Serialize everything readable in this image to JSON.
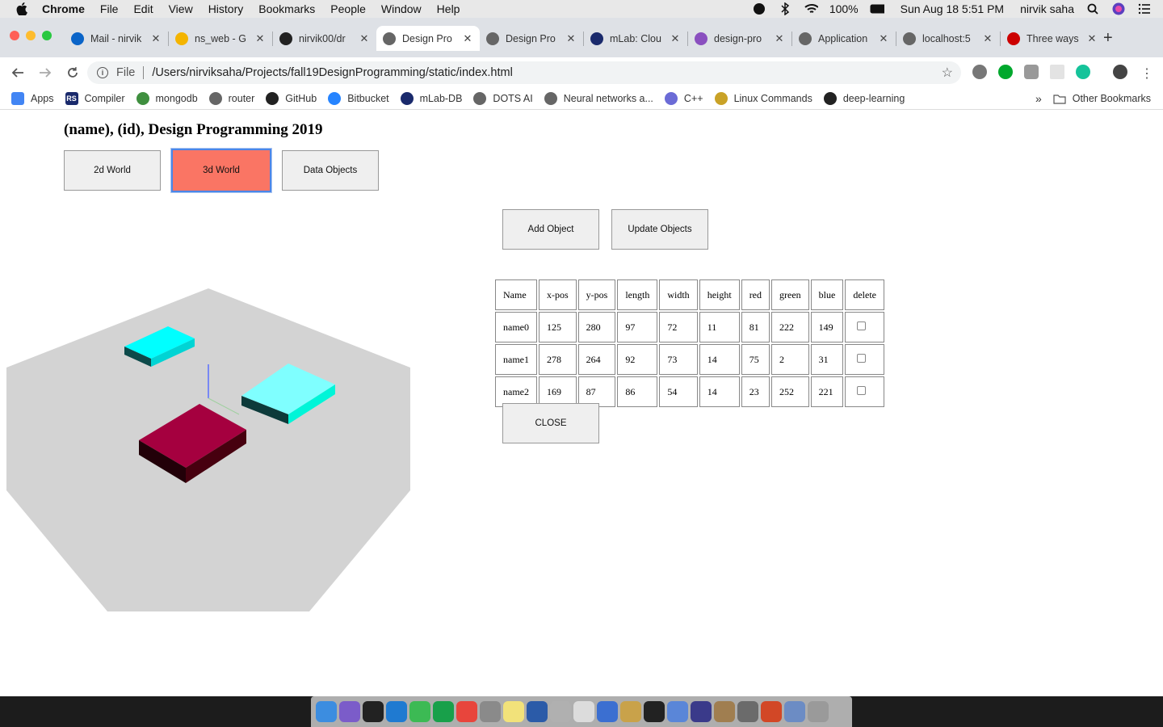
{
  "menubar": {
    "app": "Chrome",
    "menus": [
      "File",
      "Edit",
      "View",
      "History",
      "Bookmarks",
      "People",
      "Window",
      "Help"
    ],
    "battery": "100%",
    "datetime": "Sun Aug 18  5:51 PM",
    "user": "nirvik saha"
  },
  "tabs": [
    {
      "title": "Mail - nirvik",
      "color": "#0a64c8"
    },
    {
      "title": "ns_web - G",
      "color": "#f4b400"
    },
    {
      "title": "nirvik00/dr",
      "color": "#222222"
    },
    {
      "title": "Design Pro",
      "color": "#666666"
    },
    {
      "title": "Design Pro",
      "color": "#666666"
    },
    {
      "title": "mLab: Clou",
      "color": "#1a2a6c"
    },
    {
      "title": "design-pro",
      "color": "#8a4fbf"
    },
    {
      "title": "Application",
      "color": "#666666"
    },
    {
      "title": "localhost:5",
      "color": "#666666"
    },
    {
      "title": "Three ways",
      "color": "#cc0000"
    }
  ],
  "omnibox": {
    "scheme": "File",
    "url": "/Users/nirviksaha/Projects/fall19DesignProgramming/static/index.html"
  },
  "bookmarks": [
    {
      "label": "Apps",
      "color": "#4285f4"
    },
    {
      "label": "Compiler",
      "color": "#1a2a6c",
      "mark": "RS"
    },
    {
      "label": "mongodb",
      "color": "#3f8f3f"
    },
    {
      "label": "router",
      "color": "#666666"
    },
    {
      "label": "GitHub",
      "color": "#222222"
    },
    {
      "label": "Bitbucket",
      "color": "#2684ff"
    },
    {
      "label": "mLab-DB",
      "color": "#1a2a6c"
    },
    {
      "label": "DOTS AI",
      "color": "#666666"
    },
    {
      "label": "Neural networks a...",
      "color": "#666666"
    },
    {
      "label": "C++",
      "color": "#6b6bd6"
    },
    {
      "label": "Linux Commands",
      "color": "#c9a227"
    },
    {
      "label": "deep-learning",
      "color": "#222222"
    }
  ],
  "other_bookmarks": "Other Bookmarks",
  "page": {
    "title": "(name), (id), Design Programming 2019",
    "buttons": {
      "world2d": "2d World",
      "world3d": "3d World",
      "data_objects": "Data Objects",
      "add_object": "Add Object",
      "update_objects": "Update Objects",
      "close": "CLOSE"
    },
    "table": {
      "headers": [
        "Name",
        "x-pos",
        "y-pos",
        "length",
        "width",
        "height",
        "red",
        "green",
        "blue",
        "delete"
      ],
      "rows": [
        [
          "name0",
          "125",
          "280",
          "97",
          "72",
          "11",
          "81",
          "222",
          "149"
        ],
        [
          "name1",
          "278",
          "264",
          "92",
          "73",
          "14",
          "75",
          "2",
          "31"
        ],
        [
          "name2",
          "169",
          "87",
          "86",
          "54",
          "14",
          "23",
          "252",
          "221"
        ]
      ]
    },
    "scene_colors": {
      "ground": "#d3d3d3",
      "box_crimson": "#a5003f",
      "box_cyan": "#00ffff",
      "box_aqua": "#7fffff"
    }
  }
}
